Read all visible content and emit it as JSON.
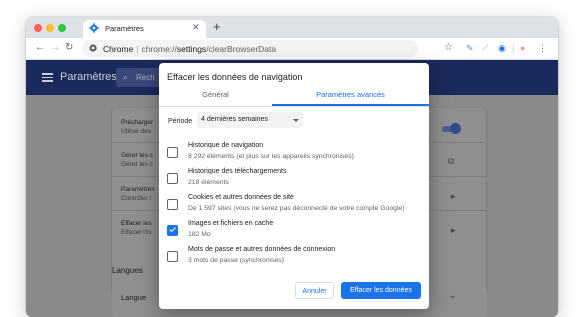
{
  "colors": {
    "accent": "#1a73e8",
    "header_bg": "#1b2a5c",
    "traffic_red": "#ff5f57",
    "traffic_yellow": "#febc2e",
    "traffic_green": "#28c840"
  },
  "browser": {
    "tab_title": "Paramètres",
    "tab_icon": "gear-icon",
    "omnibox": {
      "site": "Chrome",
      "separator": "|",
      "scheme": "chrome://",
      "host": "settings",
      "path": "/clearBrowserData"
    }
  },
  "settings": {
    "title": "Paramètres",
    "search_placeholder": "Rech",
    "rows": [
      {
        "title": "Précharger",
        "subtitle": "Utilise des"
      },
      {
        "title": "Gérer les c",
        "subtitle": "Gérer les c"
      },
      {
        "title": "Paramètres",
        "subtitle": "Contrôler l"
      },
      {
        "title": "Effacer les",
        "subtitle": "Effacer l'hi"
      }
    ],
    "section_langues": "Langues",
    "langue_row": "Langue"
  },
  "dialog": {
    "title": "Effacer les données de navigation",
    "tabs": [
      "Général",
      "Paramètres avancés"
    ],
    "active_tab": "Paramètres avancés",
    "period_label": "Période",
    "period_value": "4 dernières semaines",
    "options": [
      {
        "title": "Historique de navigation",
        "subtitle": "8 292 éléments (et plus sur les appareils synchronisés)",
        "checked": false
      },
      {
        "title": "Historique des téléchargements",
        "subtitle": "218 éléments",
        "checked": false
      },
      {
        "title": "Cookies et autres données de site",
        "subtitle": "De 1 597 sites (vous ne serez pas déconnecté de votre compte Google)",
        "checked": false
      },
      {
        "title": "Images et fichiers en cache",
        "subtitle": "182 Mo",
        "checked": true
      },
      {
        "title": "Mots de passe et autres données de connexion",
        "subtitle": "3 mots de passe (synchronisés)",
        "checked": false
      }
    ],
    "cancel_label": "Annuler",
    "confirm_label": "Effacer les données"
  }
}
